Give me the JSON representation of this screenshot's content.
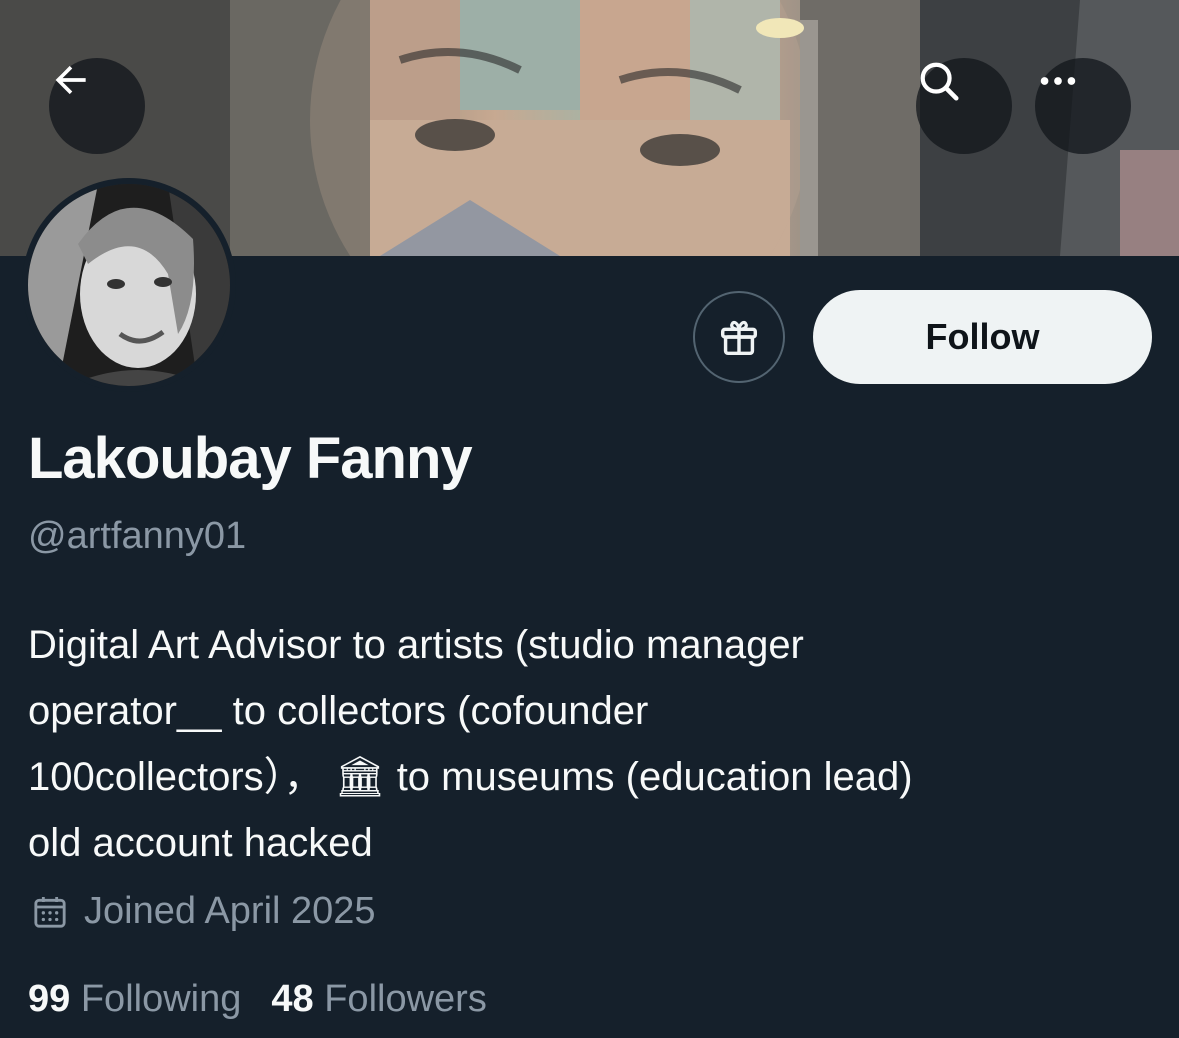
{
  "header": {
    "back_icon": "arrow-left-icon",
    "search_icon": "search-icon",
    "more_icon": "more-horizontal-icon"
  },
  "profile": {
    "name": "Lakoubay Fanny",
    "handle": "@artfanny01",
    "bio_lines": [
      "Digital Art Advisor to artists (studio manager",
      "operator__ to collectors (cofounder",
      "100collectors）， 🏛 to museums (education lead)",
      "old account hacked"
    ],
    "joined": "Joined April 2025",
    "following_count": "99",
    "following_label": "Following",
    "followers_count": "48",
    "followers_label": "Followers"
  },
  "actions": {
    "gift_icon": "gift-icon",
    "follow_label": "Follow"
  },
  "colors": {
    "background": "#15202b",
    "secondary_text": "#8b98a5",
    "follow_bg": "#eff3f4"
  }
}
